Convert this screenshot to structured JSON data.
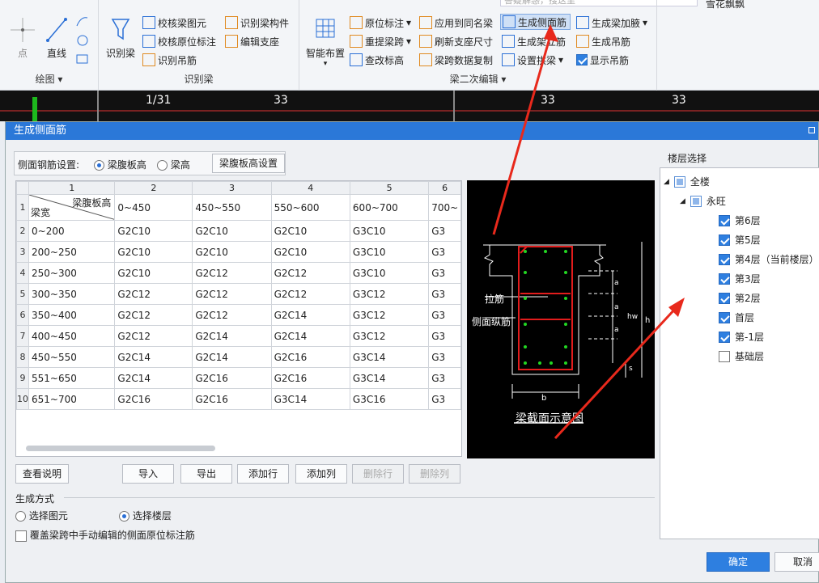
{
  "ribbon": {
    "search_placeholder": "答疑解惑，搜这里",
    "user_name": "雪花飘飘",
    "groups": {
      "draw": {
        "label": "绘图",
        "point": "点",
        "line": "直线"
      },
      "identify": {
        "label": "识别梁",
        "big": "识别梁",
        "items": [
          "校核梁图元",
          "校核原位标注",
          "识别吊筋",
          "识别梁构件",
          "编辑支座"
        ]
      },
      "edit": {
        "label": "梁二次编辑",
        "big": "智能布置",
        "items": [
          "原位标注",
          "重提梁跨",
          "查改标高",
          "应用到同名梁",
          "刷新支座尺寸",
          "梁跨数据复制",
          "生成侧面筋",
          "生成架立筋",
          "设置拱梁",
          "生成梁加腋",
          "生成吊筋",
          "显示吊筋"
        ]
      }
    }
  },
  "cad_strip": {
    "labels": [
      "1/31",
      "33",
      "33",
      "33"
    ]
  },
  "dialog": {
    "title": "生成侧面筋",
    "setting_label": "侧面钢筋设置:",
    "radio_web": "梁腹板高",
    "radio_height": "梁高",
    "web_height_button": "梁腹板高设置",
    "grid": {
      "col_numbers": [
        "1",
        "2",
        "3",
        "4",
        "5",
        "6"
      ],
      "header_top": "梁腹板高",
      "header_bottom": "梁宽",
      "ranges": [
        "0~450",
        "450~550",
        "550~600",
        "600~700",
        "700~"
      ],
      "rows": [
        {
          "n": "2",
          "w": "0~200",
          "v": [
            "G2C10",
            "G2C10",
            "G2C10",
            "G3C10",
            "G3"
          ]
        },
        {
          "n": "3",
          "w": "200~250",
          "v": [
            "G2C10",
            "G2C10",
            "G2C10",
            "G3C10",
            "G3"
          ]
        },
        {
          "n": "4",
          "w": "250~300",
          "v": [
            "G2C10",
            "G2C12",
            "G2C12",
            "G3C10",
            "G3"
          ]
        },
        {
          "n": "5",
          "w": "300~350",
          "v": [
            "G2C12",
            "G2C12",
            "G2C12",
            "G3C12",
            "G3"
          ]
        },
        {
          "n": "6",
          "w": "350~400",
          "v": [
            "G2C12",
            "G2C12",
            "G2C14",
            "G3C12",
            "G3"
          ]
        },
        {
          "n": "7",
          "w": "400~450",
          "v": [
            "G2C12",
            "G2C14",
            "G2C14",
            "G3C12",
            "G3"
          ]
        },
        {
          "n": "8",
          "w": "450~550",
          "v": [
            "G2C14",
            "G2C14",
            "G2C16",
            "G3C14",
            "G3"
          ]
        },
        {
          "n": "9",
          "w": "551~650",
          "v": [
            "G2C14",
            "G2C16",
            "G2C16",
            "G3C14",
            "G3"
          ]
        },
        {
          "n": "10",
          "w": "651~700",
          "v": [
            "G2C16",
            "G2C16",
            "G3C14",
            "G3C16",
            "G3"
          ]
        }
      ],
      "row1_number": "1"
    },
    "buttons": {
      "help": "查看说明",
      "import": "导入",
      "export": "导出",
      "add_row": "添加行",
      "add_col": "添加列",
      "del_row": "删除行",
      "del_col": "删除列",
      "ok": "确定",
      "cancel": "取消"
    },
    "diagram": {
      "tie_bar": "拉筋",
      "side_bar": "侧面纵筋",
      "caption": "梁截面示意图",
      "a": "a",
      "hw": "hw",
      "h": "h",
      "s": "s",
      "b": "b"
    },
    "gen_mode": {
      "label": "生成方式",
      "opt_element": "选择图元",
      "opt_floor": "选择楼层",
      "override": "覆盖梁跨中手动编辑的侧面原位标注筋"
    },
    "floors": {
      "label": "楼层选择",
      "all": "全楼",
      "building": "永旺",
      "items": [
        {
          "name": "第6层",
          "checked": true
        },
        {
          "name": "第5层",
          "checked": true
        },
        {
          "name": "第4层（当前楼层）",
          "checked": true
        },
        {
          "name": "第3层",
          "checked": true
        },
        {
          "name": "第2层",
          "checked": true
        },
        {
          "name": "首层",
          "checked": true
        },
        {
          "name": "第-1层",
          "checked": true
        },
        {
          "name": "基础层",
          "checked": false
        }
      ]
    }
  },
  "colors": {
    "accent": "#2e7fe0",
    "title_bar": "#2b78d8",
    "annotation_arrow": "#e8291c"
  }
}
